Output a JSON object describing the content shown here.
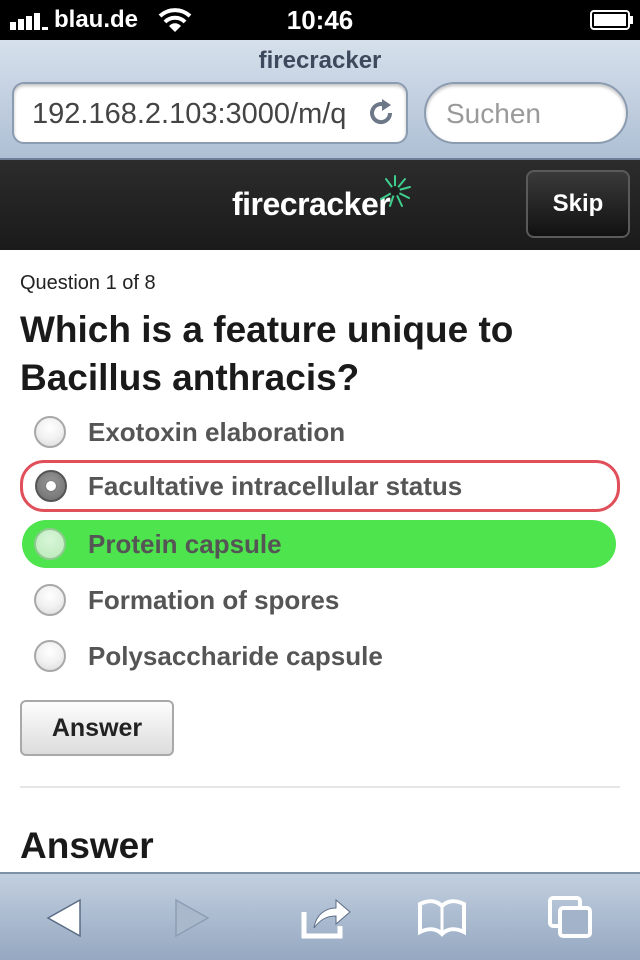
{
  "status_bar": {
    "carrier": "blau.de",
    "time": "10:46"
  },
  "browser": {
    "page_title": "firecracker",
    "url": "192.168.2.103:3000/m/q",
    "search_placeholder": "Suchen"
  },
  "header": {
    "logo_text": "firecracker",
    "skip_label": "Skip"
  },
  "quiz": {
    "counter": "Question 1 of 8",
    "question": "Which is a feature unique to Bacillus anthracis?",
    "options": [
      {
        "label": "Exotoxin elaboration",
        "state": "default"
      },
      {
        "label": "Facultative intracellular status",
        "state": "selected-wrong"
      },
      {
        "label": "Protein capsule",
        "state": "correct"
      },
      {
        "label": "Formation of spores",
        "state": "default"
      },
      {
        "label": "Polysaccharide capsule",
        "state": "default"
      }
    ],
    "answer_button": "Answer",
    "answer_heading": "Answer"
  },
  "toolbar": {
    "icons": [
      "back-icon",
      "forward-icon",
      "share-icon",
      "bookmarks-icon",
      "tabs-icon"
    ]
  },
  "colors": {
    "selected_border": "#e0505a",
    "correct_fill": "#4ee44e",
    "header_bg": "#1a1a1a",
    "logo_accent": "#3ecf8e"
  }
}
